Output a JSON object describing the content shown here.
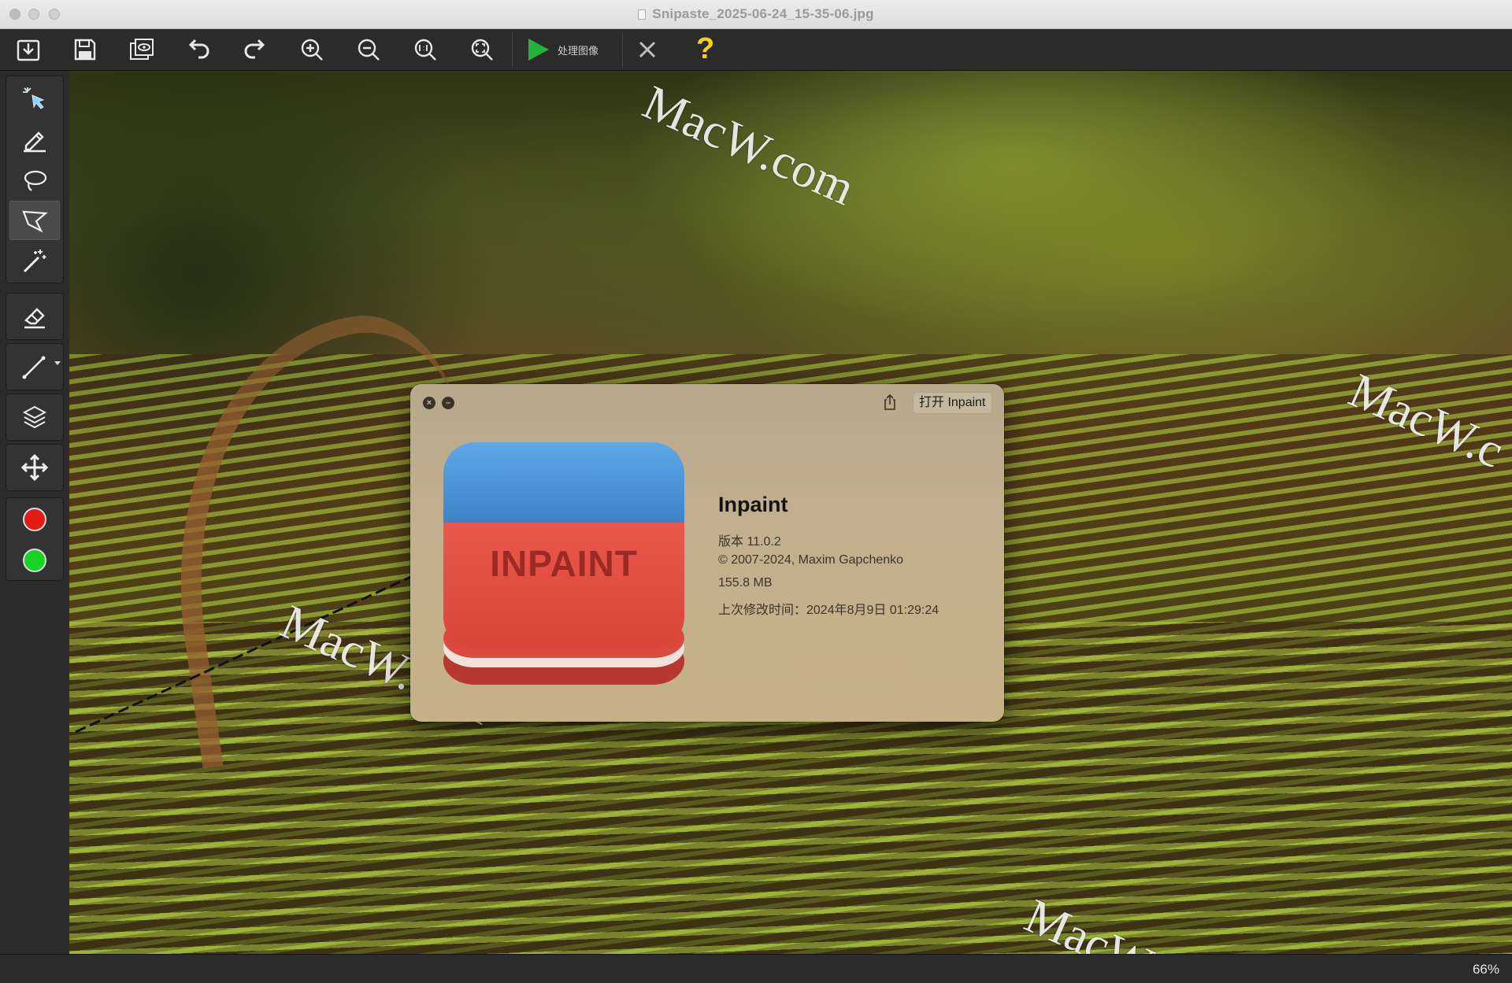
{
  "window": {
    "title": "Snipaste_2025-06-24_15-35-06.jpg"
  },
  "toolbar": {
    "process_label": "处理图像",
    "help_label": "?"
  },
  "statusbar": {
    "zoom": "66%"
  },
  "watermarks": [
    "MacW.com",
    "MacW.c",
    "MacW.com",
    "MacW"
  ],
  "colors": {
    "foreground": "#e41e17",
    "background": "#17d222",
    "help": "#f4d21a",
    "process": "#25b23a"
  },
  "about_dialog": {
    "open_button": "打开 Inpaint",
    "icon_text": "INPAINT",
    "app_name": "Inpaint",
    "version": "版本 11.0.2",
    "copyright": "© 2007-2024, Maxim Gapchenko",
    "size": "155.8 MB",
    "modified": "上次修改时间：2024年8月9日 01:29:24"
  }
}
